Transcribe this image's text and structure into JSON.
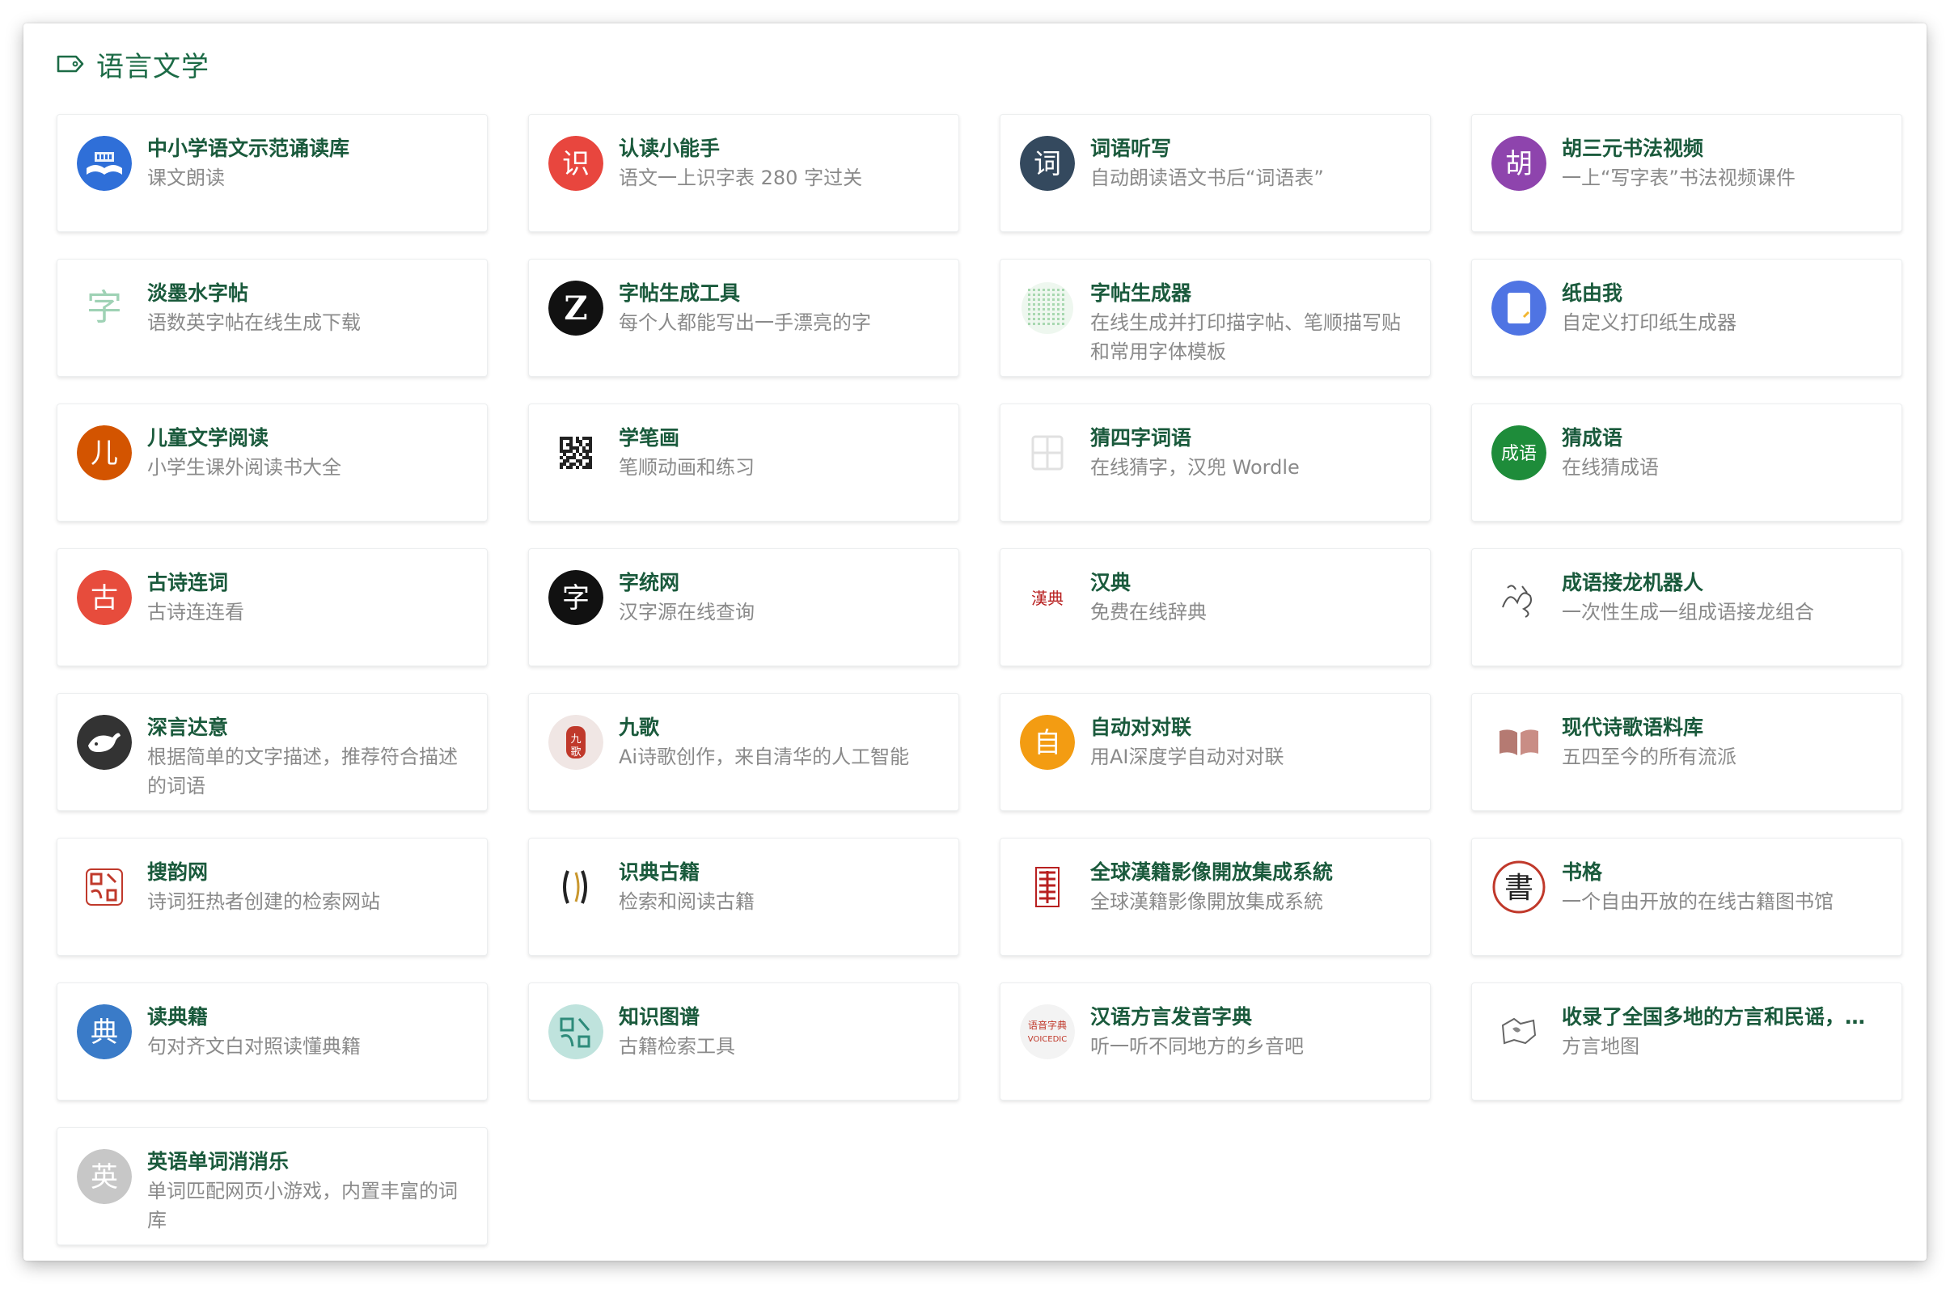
{
  "section": {
    "title": "语言文学",
    "icon": "tag-icon"
  },
  "cards": [
    {
      "title": "中小学语文示范诵读库",
      "desc": "课文朗读",
      "icon": "book-reading-icon",
      "glyph": "",
      "color": "#2f6fd8"
    },
    {
      "title": "认读小能手",
      "desc": "语文一上识字表 280 字过关",
      "icon": "shi-char-icon",
      "glyph": "识",
      "color": "#e8463e"
    },
    {
      "title": "词语听写",
      "desc": "自动朗读语文书后“词语表”",
      "icon": "ci-char-icon",
      "glyph": "词",
      "color": "#34495e"
    },
    {
      "title": "胡三元书法视频",
      "desc": "一上“写字表”书法视频课件",
      "icon": "hu-char-icon",
      "glyph": "胡",
      "color": "#8e44ad"
    },
    {
      "title": "淡墨水字帖",
      "desc": "语数英字帖在线生成下载",
      "icon": "zi-outline-icon",
      "glyph": "字",
      "color": "#ffffff"
    },
    {
      "title": "字帖生成工具",
      "desc": "每个人都能写出一手漂亮的字",
      "icon": "z-logo-icon",
      "glyph": "Z",
      "color": "#111111"
    },
    {
      "title": "字帖生成器",
      "desc": "在线生成并打印描字帖、笔顺描写贴和常用字体模板",
      "icon": "grid-dots-icon",
      "glyph": "",
      "color": "#ffffff"
    },
    {
      "title": "纸由我",
      "desc": "自定义打印纸生成器",
      "icon": "paper-icon",
      "glyph": "",
      "color": "#4f74e3"
    },
    {
      "title": "儿童文学阅读",
      "desc": "小学生课外阅读书大全",
      "icon": "er-char-icon",
      "glyph": "儿",
      "color": "#d35400"
    },
    {
      "title": "学笔画",
      "desc": "笔顺动画和练习",
      "icon": "qr-code-icon",
      "glyph": "",
      "color": "#ffffff"
    },
    {
      "title": "猜四字词语",
      "desc": "在线猜字，汉兜 Wordle",
      "icon": "four-grid-icon",
      "glyph": "",
      "color": "#ffffff"
    },
    {
      "title": "猜成语",
      "desc": "在线猜成语",
      "icon": "chengyu-icon",
      "glyph": "成语",
      "color": "#1e8c3a"
    },
    {
      "title": "古诗连词",
      "desc": "古诗连连看",
      "icon": "gu-char-icon",
      "glyph": "古",
      "color": "#e74c3c"
    },
    {
      "title": "字统网",
      "desc": "汉字源在线查询",
      "icon": "zi-black-icon",
      "glyph": "字",
      "color": "#111111"
    },
    {
      "title": "汉典",
      "desc": "免费在线辞典",
      "icon": "handian-logo-icon",
      "glyph": "漢典",
      "color": "#ffffff"
    },
    {
      "title": "成语接龙机器人",
      "desc": "一次性生成一组成语接龙组合",
      "icon": "sketch-icon",
      "glyph": "",
      "color": "#ffffff"
    },
    {
      "title": "深言达意",
      "desc": "根据简单的文字描述，推荐符合描述的词语",
      "icon": "whale-icon",
      "glyph": "",
      "color": "#333333"
    },
    {
      "title": "九歌",
      "desc": "Ai诗歌创作，来自清华的人工智能",
      "icon": "jiuge-seal-icon",
      "glyph": "",
      "color": "#f0e6e4"
    },
    {
      "title": "自动对对联",
      "desc": "用AI深度学自动对对联",
      "icon": "zi-self-icon",
      "glyph": "自",
      "color": "#f39c12"
    },
    {
      "title": "现代诗歌语料库",
      "desc": "五四至今的所有流派",
      "icon": "open-book-icon",
      "glyph": "",
      "color": "#ffffff"
    },
    {
      "title": "搜韵网",
      "desc": "诗词狂热者创建的检索网站",
      "icon": "souyun-seal-icon",
      "glyph": "",
      "color": "#ffffff"
    },
    {
      "title": "识典古籍",
      "desc": "检索和阅读古籍",
      "icon": "brackets-icon",
      "glyph": "",
      "color": "#ffffff"
    },
    {
      "title": "全球漢籍影像開放集成系統",
      "desc": "全球漢籍影像開放集成系統",
      "icon": "red-seal-icon",
      "glyph": "",
      "color": "#ffffff"
    },
    {
      "title": "书格",
      "desc": "一个自由开放的在线古籍图书馆",
      "icon": "shu-circle-icon",
      "glyph": "書",
      "color": "#ffffff"
    },
    {
      "title": "读典籍",
      "desc": "句对齐文白对照读懂典籍",
      "icon": "dian-char-icon",
      "glyph": "典",
      "color": "#3a7bc8"
    },
    {
      "title": "知识图谱",
      "desc": "古籍检索工具",
      "icon": "teal-seal-icon",
      "glyph": "",
      "color": "#bfe3dd"
    },
    {
      "title": "汉语方言发音字典",
      "desc": "听一听不同地方的乡音吧",
      "icon": "voicedic-icon",
      "glyph": "",
      "color": "#f3f3f3"
    },
    {
      "title": "收录了全国多地的方言和民谣，也可以查看全国方言地图",
      "desc": "方言地图",
      "icon": "map-sketch-icon",
      "glyph": "",
      "color": "#ffffff"
    },
    {
      "title": "英语单词消消乐",
      "desc": "单词匹配网页小游戏，内置丰富的词库",
      "icon": "ying-char-icon",
      "glyph": "英",
      "color": "#c7c7c7"
    }
  ]
}
